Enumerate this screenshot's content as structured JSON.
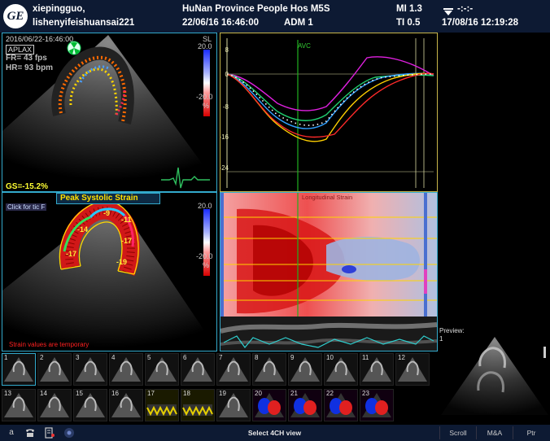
{
  "header": {
    "patient_id": "xiepingguo,",
    "patient_name": "lishenyifeishuansai221",
    "hospital": "HuNan Province People Hos M5S",
    "datetime": "22/06/16 16:46:00",
    "operator": "ADM 1",
    "mi": "MI 1.3",
    "ti": "TI 0.5",
    "clock_top": "-:-:-",
    "clock_date": "17/08/16 12:19:28",
    "logo": "GE"
  },
  "top_image": {
    "timestamp": "2016/06/22-16:46:00",
    "view": "APLAX",
    "fr": "FR= 43 fps",
    "hr": "HR= 93 bpm",
    "scale_label": "SL",
    "scale_top": "20.0",
    "scale_bottom": "-20.0",
    "scale_unit": "%",
    "gs": "GS=-15.2%"
  },
  "bottom_image": {
    "title": "Peak Systolic Strain",
    "click_hint": "Click for tic F",
    "scale_top": "20.0",
    "scale_bottom": "-20.0",
    "scale_unit": "%",
    "warning": "Strain values are temporary",
    "segment_values": [
      "-9",
      "-11",
      "-14",
      "-17",
      "-17",
      "-19"
    ]
  },
  "strain_graph": {
    "avc_label": "AVC",
    "y_ticks": [
      "8",
      "0",
      "-8",
      "-16",
      "-24"
    ]
  },
  "mmode": {
    "title": "Longitudinal Strain"
  },
  "preview": {
    "label": "Preview:",
    "index": "1"
  },
  "thumbnails": [
    {
      "n": "1",
      "kind": "echo"
    },
    {
      "n": "2",
      "kind": "echo"
    },
    {
      "n": "3",
      "kind": "echo"
    },
    {
      "n": "4",
      "kind": "echo"
    },
    {
      "n": "5",
      "kind": "echo"
    },
    {
      "n": "6",
      "kind": "echo"
    },
    {
      "n": "7",
      "kind": "echo"
    },
    {
      "n": "8",
      "kind": "echo"
    },
    {
      "n": "9",
      "kind": "echo"
    },
    {
      "n": "10",
      "kind": "echo"
    },
    {
      "n": "11",
      "kind": "echo"
    },
    {
      "n": "12",
      "kind": "echo"
    },
    {
      "n": "13",
      "kind": "echo"
    },
    {
      "n": "14",
      "kind": "echo"
    },
    {
      "n": "15",
      "kind": "echo"
    },
    {
      "n": "16",
      "kind": "echo"
    },
    {
      "n": "17",
      "kind": "doppler"
    },
    {
      "n": "18",
      "kind": "doppler"
    },
    {
      "n": "19",
      "kind": "echo"
    },
    {
      "n": "20",
      "kind": "color"
    },
    {
      "n": "21",
      "kind": "color"
    },
    {
      "n": "22",
      "kind": "color"
    },
    {
      "n": "23",
      "kind": "color"
    }
  ],
  "bottom_bar": {
    "status": "Select 4CH view",
    "scroll": "Scroll",
    "mna": "M&A",
    "ptr": "Ptr",
    "left_a": "a"
  },
  "colors": {
    "header_bg": "#0d1a33",
    "panel_border": "#33aacc",
    "strain_label": "#ff2222",
    "gs_label": "#ffff33"
  }
}
